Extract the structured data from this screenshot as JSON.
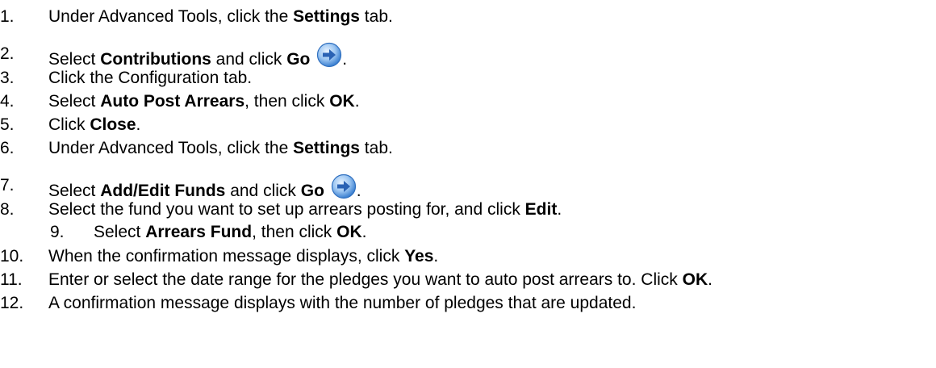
{
  "steps": [
    {
      "num": "1.",
      "parts": [
        "Under Advanced Tools, click the ",
        "Settings",
        " tab."
      ]
    },
    {
      "num": "2.",
      "parts": [
        "Select ",
        "Contributions",
        " and click ",
        "Go",
        "."
      ]
    },
    {
      "num": "3.",
      "parts": [
        "Click the Configuration tab."
      ]
    },
    {
      "num": "4.",
      "parts": [
        "Select ",
        "Auto Post Arrears",
        ", then click ",
        "OK",
        "."
      ]
    },
    {
      "num": "5.",
      "parts": [
        "Click ",
        "Close",
        "."
      ]
    },
    {
      "num": "6.",
      "parts": [
        "Under Advanced Tools, click the ",
        "Settings",
        " tab."
      ]
    },
    {
      "num": "7.",
      "parts": [
        "Select ",
        "Add/Edit Funds",
        " and click ",
        "Go",
        "."
      ]
    },
    {
      "num": "8.",
      "parts": [
        "Select the fund you want to set up arrears posting for, and click ",
        "Edit",
        "."
      ]
    },
    {
      "num": "9.",
      "parts": [
        "Select ",
        "Arrears Fund",
        ", then click ",
        "OK",
        "."
      ]
    },
    {
      "num": "10.",
      "parts": [
        "When the confirmation message displays, click ",
        "Yes",
        "."
      ]
    },
    {
      "num": "11.",
      "parts": [
        "Enter or select the date range for the pledges you want to auto post arrears to. Click ",
        "OK",
        "."
      ]
    },
    {
      "num": "12.",
      "parts": [
        "A confirmation message displays with the number of pledges that are updated."
      ]
    }
  ],
  "icons": {
    "go_icon": "go-arrow-icon",
    "go_icon_color": "#3a7fd0"
  }
}
